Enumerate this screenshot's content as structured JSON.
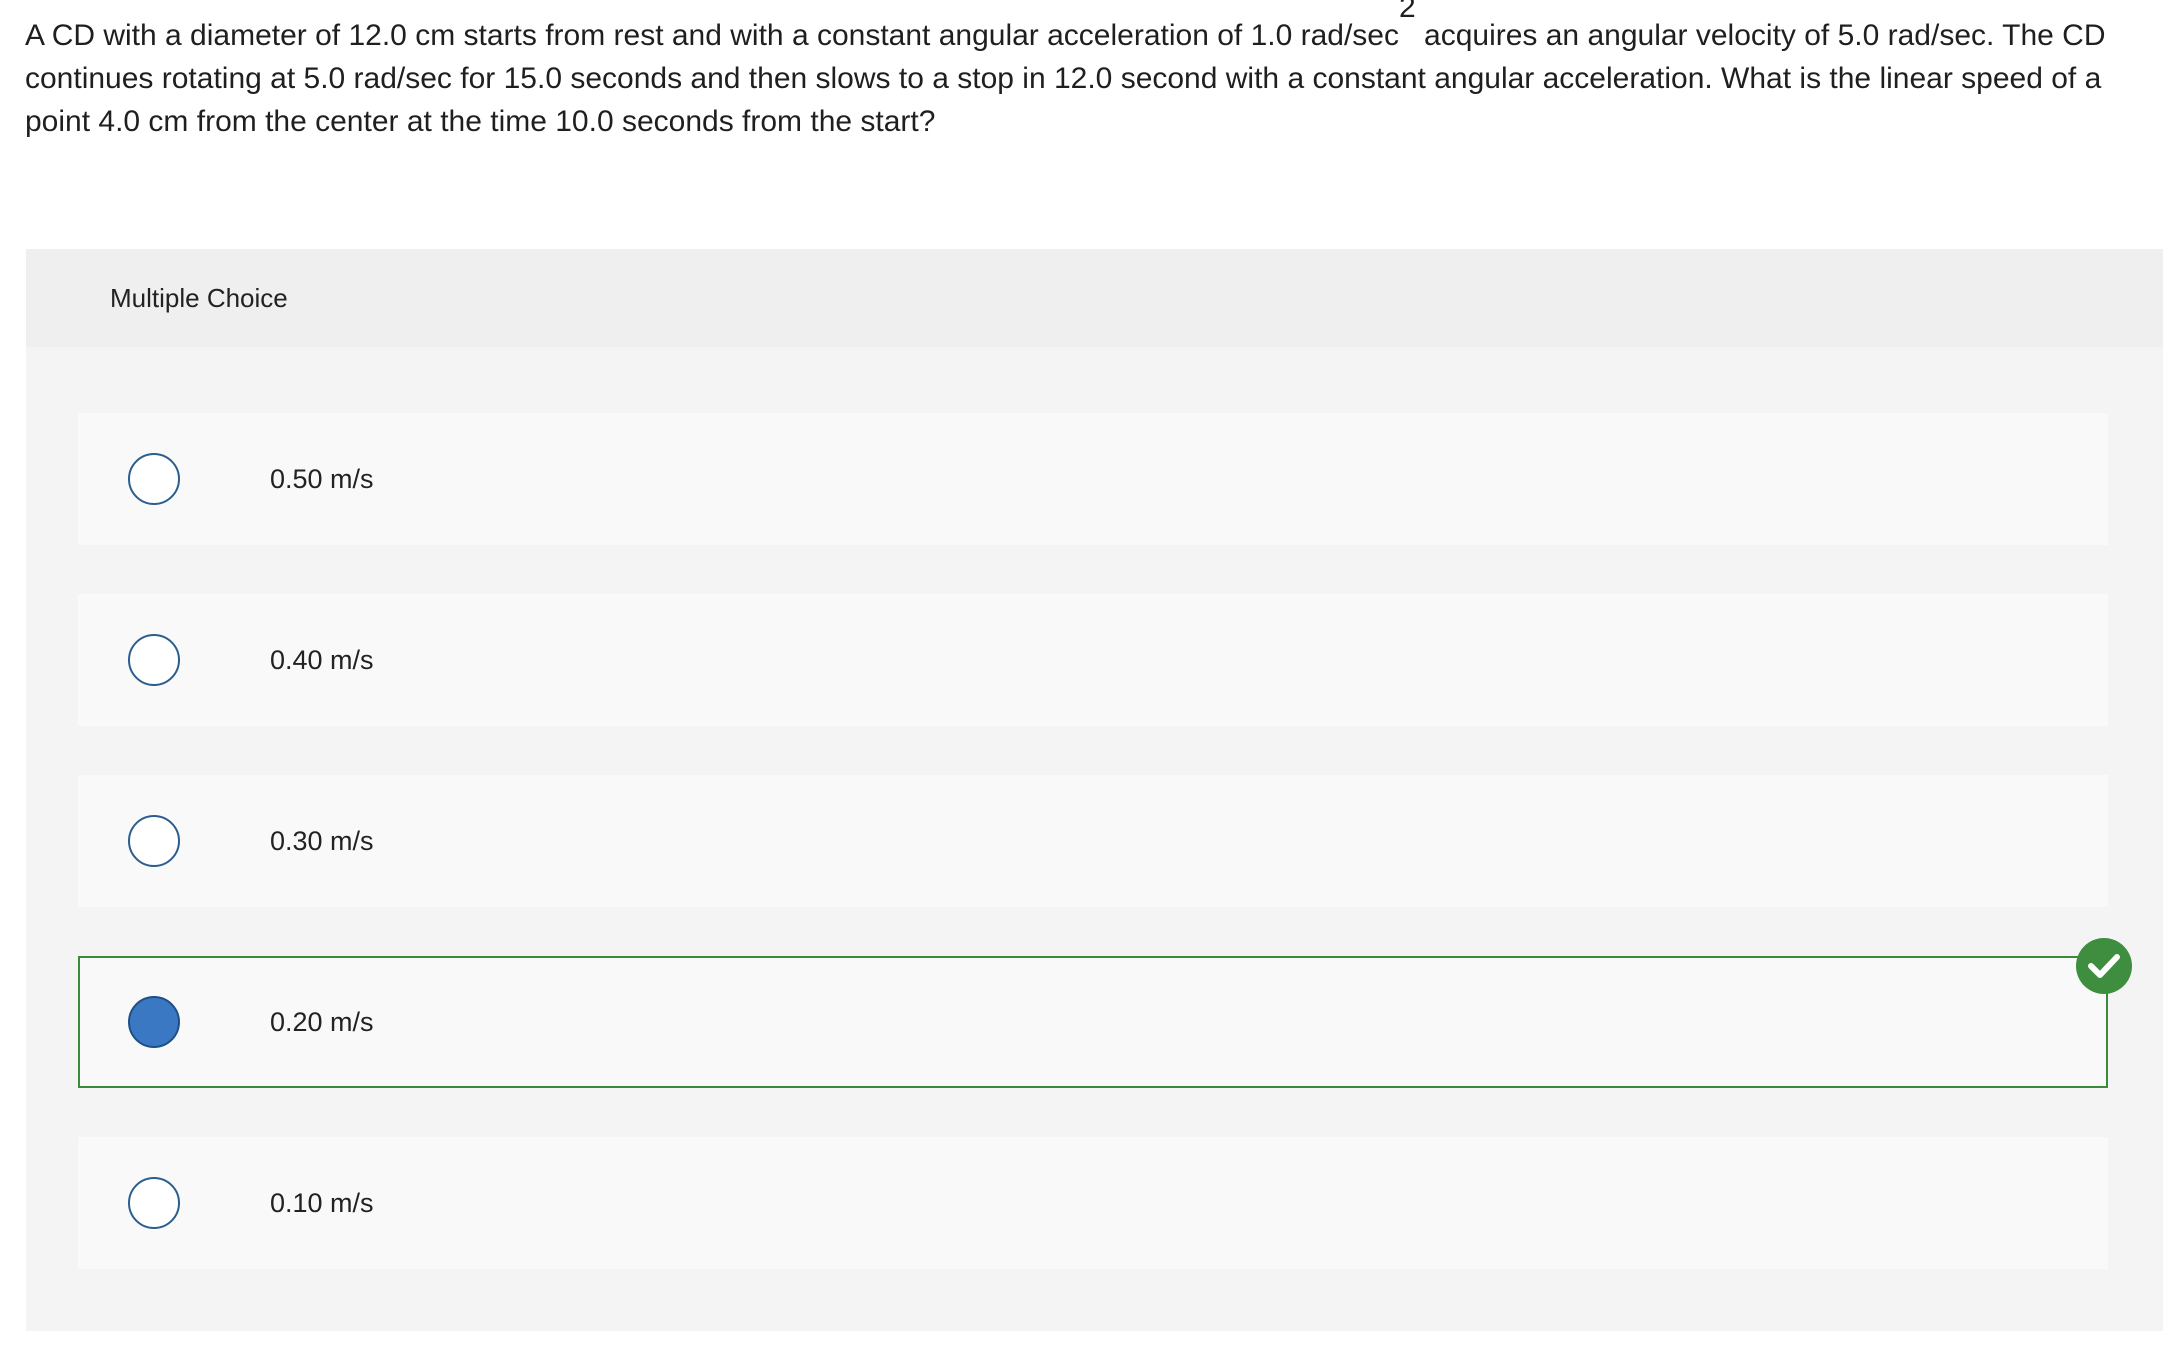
{
  "question": {
    "text_before_sup": "A CD with a diameter of 12.0 cm starts from rest and with a constant angular acceleration of 1.0 rad/sec",
    "superscript": "2",
    "text_after_sup": " acquires an angular velocity of 5.0 rad/sec. The CD continues rotating at 5.0 rad/sec for 15.0 seconds and then slows to a stop in 12.0 second with a constant angular acceleration. What is the linear speed of a point 4.0 cm from the center at the time 10.0 seconds from the start?"
  },
  "multiple_choice": {
    "header": "Multiple Choice",
    "options": [
      {
        "label": "0.50 m/s",
        "selected": false
      },
      {
        "label": "0.40 m/s",
        "selected": false
      },
      {
        "label": "0.30 m/s",
        "selected": false
      },
      {
        "label": "0.20 m/s",
        "selected": true,
        "correct": true
      },
      {
        "label": "0.10 m/s",
        "selected": false
      }
    ]
  },
  "colors": {
    "radio_border": "#2c5d8f",
    "radio_selected_fill": "#3a78c3",
    "correct_green": "#3f8d3f",
    "panel_bg": "#f4f4f4"
  },
  "icons": {
    "correct": "check-circle-icon"
  }
}
